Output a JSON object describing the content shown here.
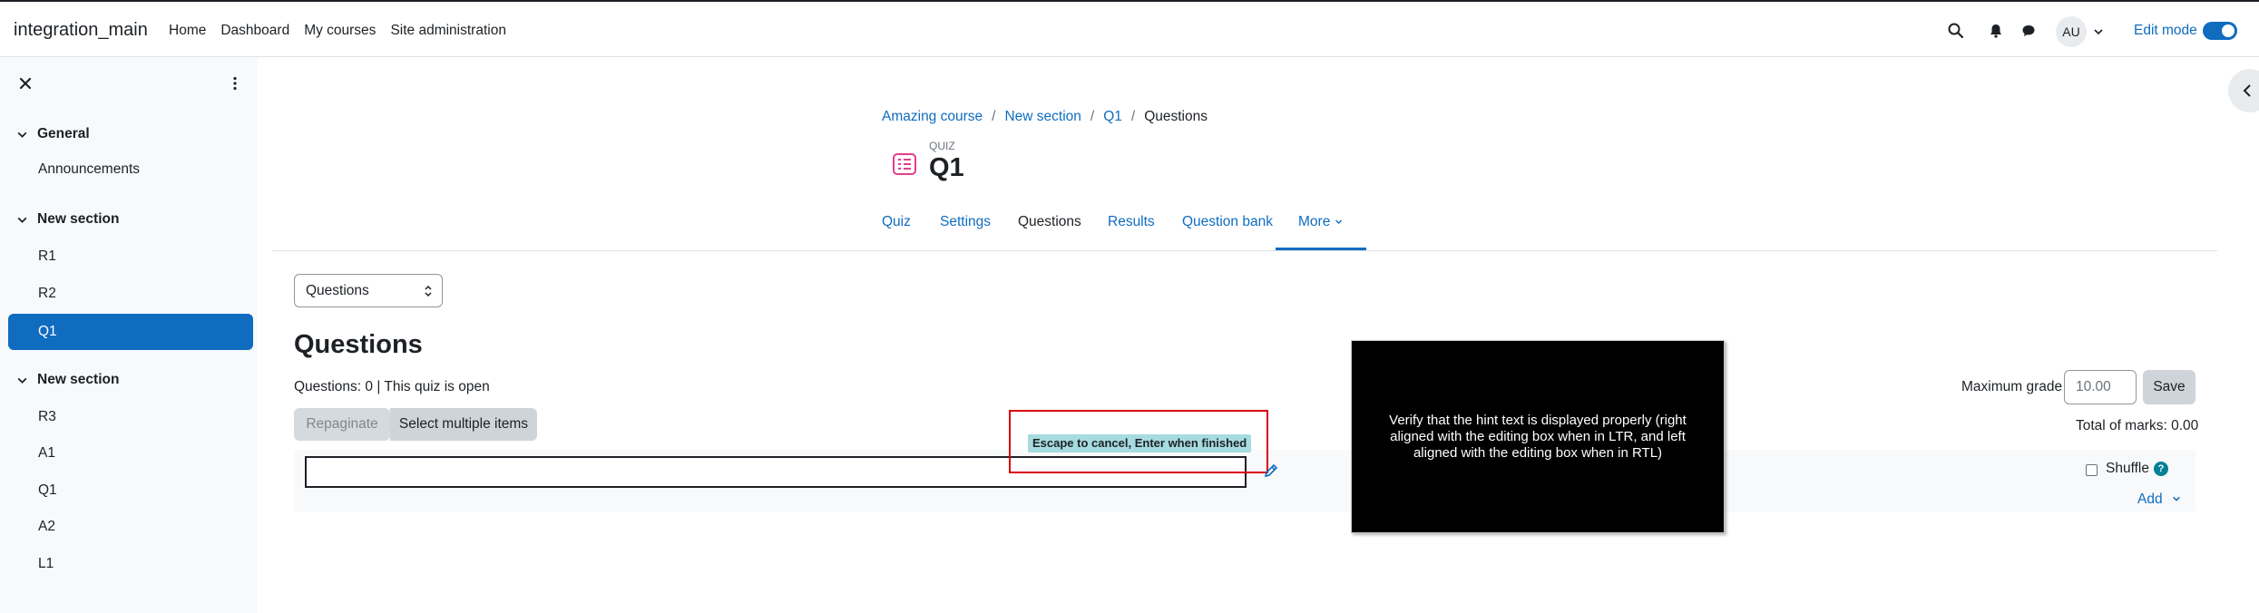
{
  "navbar": {
    "brand": "integration_main",
    "items": [
      "Home",
      "Dashboard",
      "My courses",
      "Site administration"
    ],
    "avatar_initials": "AU",
    "edit_mode_label": "Edit mode",
    "edit_mode_on": true
  },
  "drawer": {
    "sections": [
      {
        "title": "General",
        "items": [
          "Announcements"
        ]
      },
      {
        "title": "New section",
        "items": [
          "R1",
          "R2",
          "Q1"
        ]
      },
      {
        "title": "New section",
        "items": [
          "R3",
          "A1",
          "Q1",
          "A2",
          "L1"
        ]
      }
    ],
    "active_item": "Q1"
  },
  "breadcrumb": [
    "Amazing course",
    "New section",
    "Q1",
    "Questions"
  ],
  "header": {
    "activity_type": "QUIZ",
    "title": "Q1"
  },
  "secondary_nav": {
    "tabs": [
      "Quiz",
      "Settings",
      "Questions",
      "Results",
      "Question bank",
      "More"
    ],
    "active": "Questions"
  },
  "main": {
    "select_value": "Questions",
    "heading": "Questions",
    "info": "Questions: 0 | This quiz is open",
    "repaginate_label": "Repaginate",
    "select_multiple_label": "Select multiple items",
    "max_grade_label": "Maximum grade",
    "max_grade_value": "10.00",
    "save_label": "Save",
    "total_marks": "Total of marks: 0.00",
    "edit_hint": "Escape to cancel, Enter when finished",
    "shuffle_label": "Shuffle",
    "help_glyph": "?",
    "add_label": "Add"
  },
  "note": "Verify that the hint text is displayed properly (right aligned with the editing box when in LTR, and left aligned with the editing box when in RTL)",
  "colors": {
    "brand_blue": "#0f6cbf",
    "hint_bg": "#a6dbe0",
    "outline_red": "#d9000e"
  }
}
